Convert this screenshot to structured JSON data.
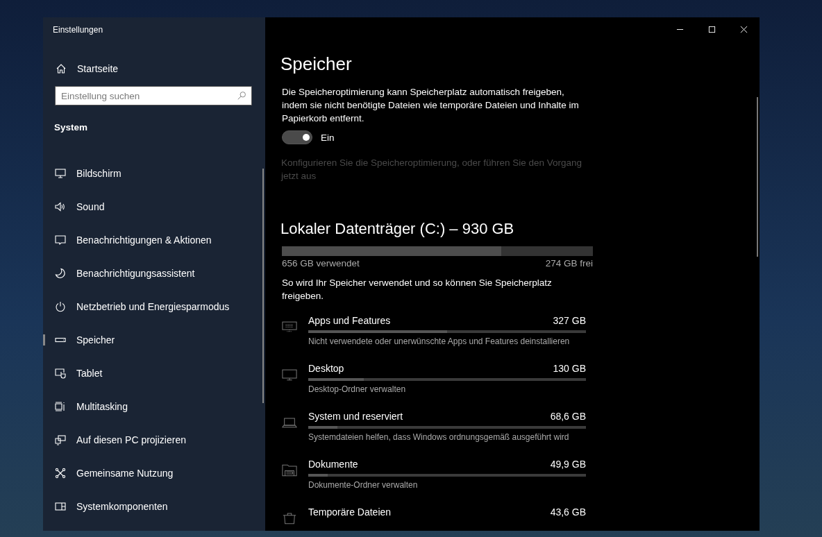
{
  "window": {
    "title": "Einstellungen"
  },
  "sidebar": {
    "home": "Startseite",
    "search": {
      "placeholder": "Einstellung suchen"
    },
    "section": "System",
    "items": [
      {
        "label": "Bildschirm",
        "selected": false
      },
      {
        "label": "Sound",
        "selected": false
      },
      {
        "label": "Benachrichtigungen & Aktionen",
        "selected": false
      },
      {
        "label": "Benachrichtigungsassistent",
        "selected": false
      },
      {
        "label": "Netzbetrieb und Energiesparmodus",
        "selected": false
      },
      {
        "label": "Speicher",
        "selected": true
      },
      {
        "label": "Tablet",
        "selected": false
      },
      {
        "label": "Multitasking",
        "selected": false
      },
      {
        "label": "Auf diesen PC projizieren",
        "selected": false
      },
      {
        "label": "Gemeinsame Nutzung",
        "selected": false
      },
      {
        "label": "Systemkomponenten",
        "selected": false
      }
    ]
  },
  "page": {
    "title": "Speicher",
    "description": "Die Speicheroptimierung kann Speicherplatz automatisch freigeben, indem sie nicht benötigte Dateien wie temporäre Dateien und Inhalte im Papierkorb entfernt.",
    "toggle": {
      "on": true,
      "label": "Ein"
    },
    "configure_link": {
      "label": "Konfigurieren Sie die Speicheroptimierung, oder führen Sie den Vorgang jetzt aus",
      "disabled": true
    },
    "drive": {
      "title": "Lokaler Datenträger (C:) – 930 GB",
      "level": 0.705,
      "used": "656 GB verwendet",
      "free": "274 GB frei"
    },
    "usage_intro": "So wird Ihr Speicher verwendet und so können Sie Speicherplatz freigeben.",
    "categories": [
      {
        "name": "Apps und Features",
        "size": "327 GB",
        "level": 0.5,
        "description": "Nicht verwendete oder unerwünschte Apps und Features deinstallieren"
      },
      {
        "name": "Desktop",
        "size": "130 GB",
        "level": 0.2,
        "description": "Desktop-Ordner verwalten"
      },
      {
        "name": "System und reserviert",
        "size": "68,6 GB",
        "level": 0.105,
        "description": "Systemdateien helfen, dass Windows ordnungsgemäß ausgeführt wird"
      },
      {
        "name": "Dokumente",
        "size": "49,9 GB",
        "level": 0.07,
        "description": "Dokumente-Ordner verwalten"
      },
      {
        "name": "Temporäre Dateien",
        "size": "43,6 GB"
      }
    ]
  }
}
